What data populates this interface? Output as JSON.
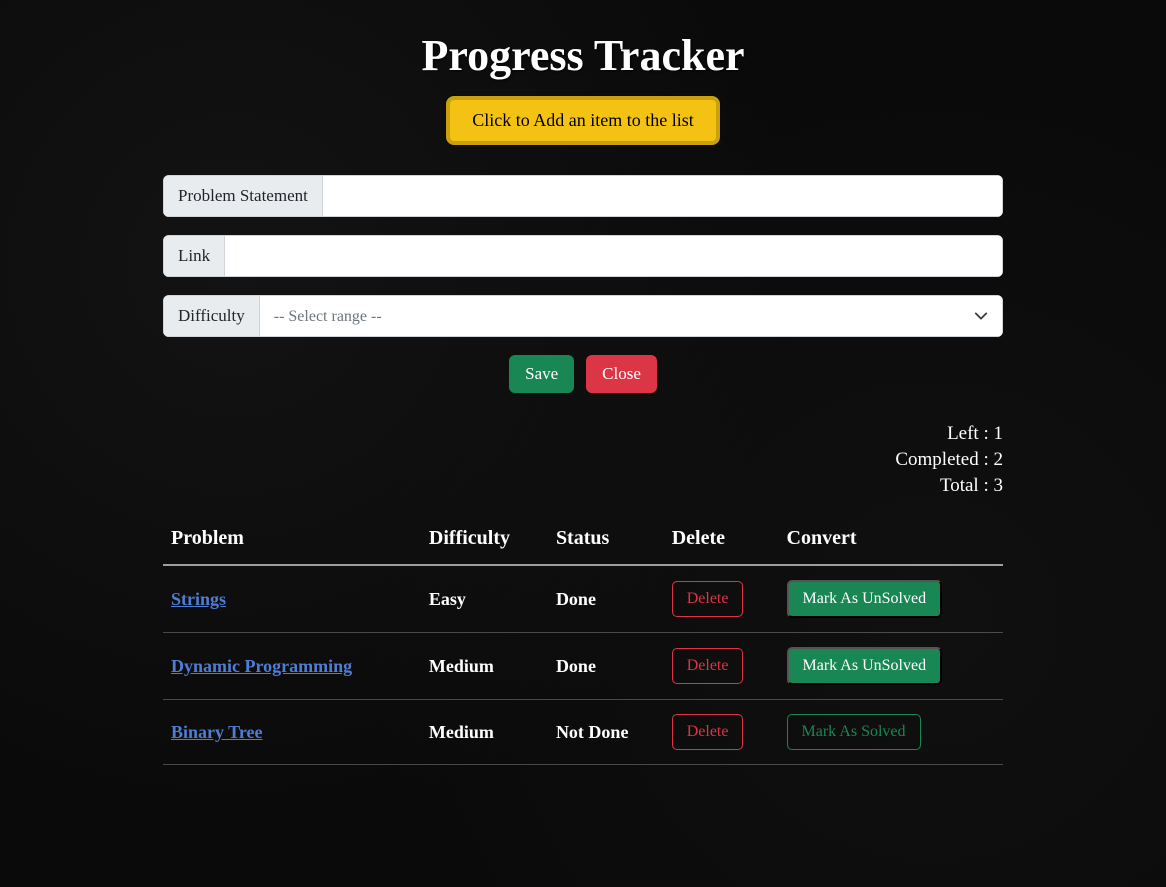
{
  "title": "Progress Tracker",
  "add_button_label": "Click to Add an item to the list",
  "form": {
    "problem_label": "Problem Statement",
    "problem_value": "",
    "link_label": "Link",
    "link_value": "",
    "difficulty_label": "Difficulty",
    "difficulty_placeholder": "-- Select range --",
    "save_label": "Save",
    "close_label": "Close"
  },
  "stats": {
    "left_label": "Left : ",
    "left_value": "1",
    "completed_label": "Completed : ",
    "completed_value": "2",
    "total_label": "Total : ",
    "total_value": "3"
  },
  "table": {
    "headers": {
      "problem": "Problem",
      "difficulty": "Difficulty",
      "status": "Status",
      "delete": "Delete",
      "convert": "Convert"
    },
    "rows": [
      {
        "problem": "Strings",
        "difficulty": "Easy",
        "status": "Done",
        "delete_label": "Delete",
        "convert_label": "Mark As UnSolved",
        "solved": true
      },
      {
        "problem": "Dynamic Programming",
        "difficulty": "Medium",
        "status": "Done",
        "delete_label": "Delete",
        "convert_label": "Mark As UnSolved",
        "solved": true
      },
      {
        "problem": "Binary Tree",
        "difficulty": "Medium",
        "status": "Not Done",
        "delete_label": "Delete",
        "convert_label": "Mark As Solved",
        "solved": false
      }
    ]
  }
}
